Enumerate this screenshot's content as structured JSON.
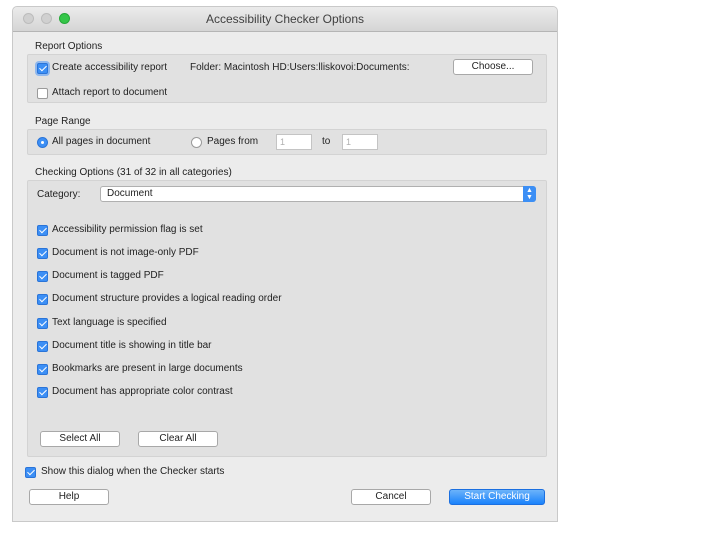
{
  "window": {
    "title": "Accessibility Checker Options"
  },
  "report_options": {
    "heading": "Report Options",
    "create_report_label": "Create accessibility report",
    "create_report_checked": true,
    "folder_text": "Folder: Macintosh HD:Users:lliskovoi:Documents:",
    "choose_label": "Choose...",
    "attach_label": "Attach report to document",
    "attach_checked": false
  },
  "page_range": {
    "heading": "Page Range",
    "all_pages_label": "All pages in document",
    "all_pages_selected": true,
    "pages_from_label": "Pages from",
    "from_value": "1",
    "to_label": "to",
    "to_value": "1"
  },
  "checking_options": {
    "heading": "Checking Options (31 of 32 in all categories)",
    "category_label": "Category:",
    "category_value": "Document",
    "items": [
      {
        "label": "Accessibility permission flag is set",
        "checked": true
      },
      {
        "label": "Document is not image-only PDF",
        "checked": true
      },
      {
        "label": "Document is tagged PDF",
        "checked": true
      },
      {
        "label": "Document structure provides a logical reading order",
        "checked": true
      },
      {
        "label": "Text language is specified",
        "checked": true
      },
      {
        "label": "Document title is showing in title bar",
        "checked": true
      },
      {
        "label": "Bookmarks are present in large documents",
        "checked": true
      },
      {
        "label": "Document has appropriate color contrast",
        "checked": true
      }
    ],
    "select_all_label": "Select All",
    "clear_all_label": "Clear All"
  },
  "footer": {
    "show_dialog_label": "Show this dialog when the Checker starts",
    "show_dialog_checked": true,
    "help_label": "Help",
    "cancel_label": "Cancel",
    "start_label": "Start Checking"
  },
  "colors": {
    "accent": "#3c8ff5",
    "primary_button": "#1a82fb"
  }
}
